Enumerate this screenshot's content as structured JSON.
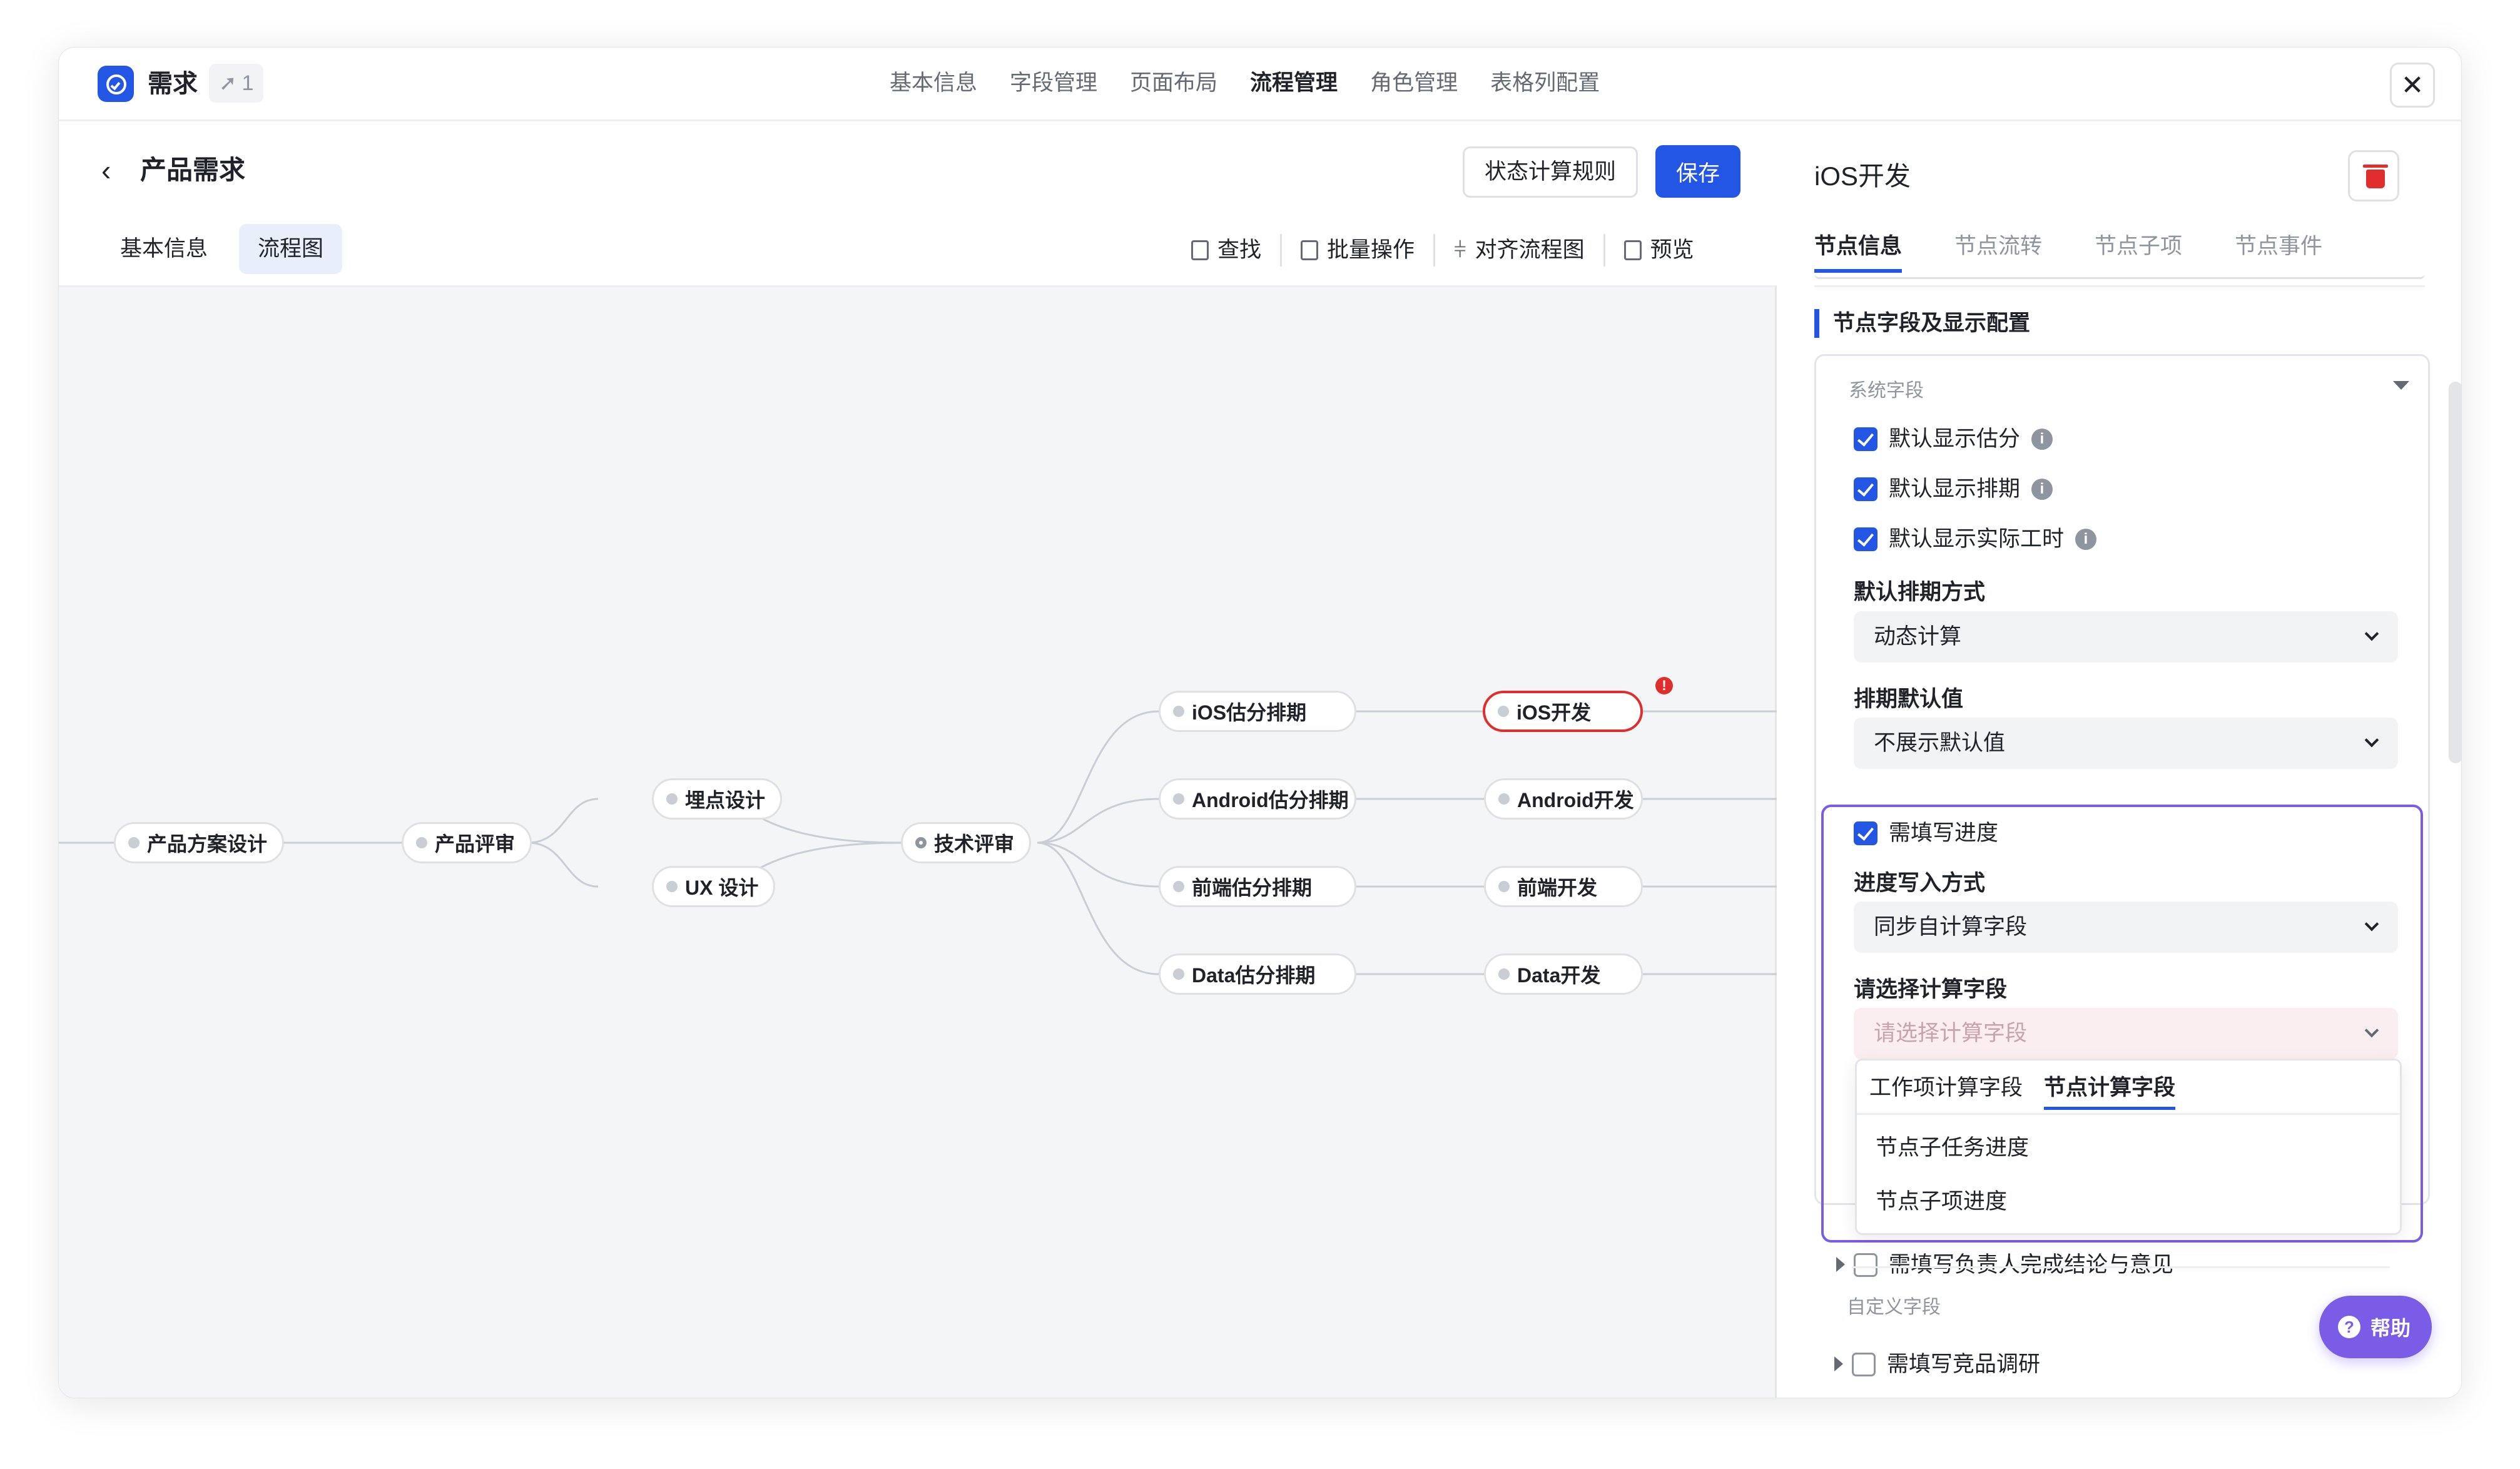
{
  "app": {
    "title": "需求",
    "share_count": "1"
  },
  "top_tabs": [
    "基本信息",
    "字段管理",
    "页面布局",
    "流程管理",
    "角色管理",
    "表格列配置"
  ],
  "active_top_tab": "流程管理",
  "page": {
    "title": "产品需求",
    "rule_button": "状态计算规则",
    "save_button": "保存"
  },
  "view_tabs": [
    "基本信息",
    "流程图"
  ],
  "toolbar": [
    "查找",
    "批量操作",
    "对齐流程图",
    "预览"
  ],
  "flow_nodes": {
    "n1": "产品方案设计",
    "n2": "产品评审",
    "n3": "埋点设计",
    "n4": "UX 设计",
    "n5": "技术评审",
    "n6": "iOS估分排期",
    "n7": "Android估分排期",
    "n8": "前端估分排期",
    "n9": "Data估分排期",
    "n10": "iOS开发",
    "n11": "Android开发",
    "n12": "前端开发",
    "n13": "Data开发"
  },
  "error_badge": "!",
  "panel": {
    "node_name": "iOS开发",
    "tabs": [
      "节点信息",
      "节点流转",
      "节点子项",
      "节点事件"
    ],
    "section_title": "节点字段及显示配置",
    "system_fields_label": "系统字段",
    "checks": {
      "estimate": "默认显示估分",
      "schedule": "默认显示排期",
      "actual_hours": "默认显示实际工时"
    },
    "schedule_mode_label": "默认排期方式",
    "schedule_mode_value": "动态计算",
    "schedule_default_label": "排期默认值",
    "schedule_default_value": "不展示默认值",
    "progress_required": "需填写进度",
    "progress_mode_label": "进度写入方式",
    "progress_mode_value": "同步自计算字段",
    "calc_field_label": "请选择计算字段",
    "calc_field_placeholder": "请选择计算字段",
    "dropdown_tabs": [
      "工作项计算字段",
      "节点计算字段"
    ],
    "dropdown_items": [
      "节点子任务进度",
      "节点子项进度"
    ],
    "conclusion_required": "需填写负责人完成结论与意见",
    "custom_fields_label": "自定义字段",
    "competitor_research": "需填写竞品调研"
  },
  "help": "帮助"
}
